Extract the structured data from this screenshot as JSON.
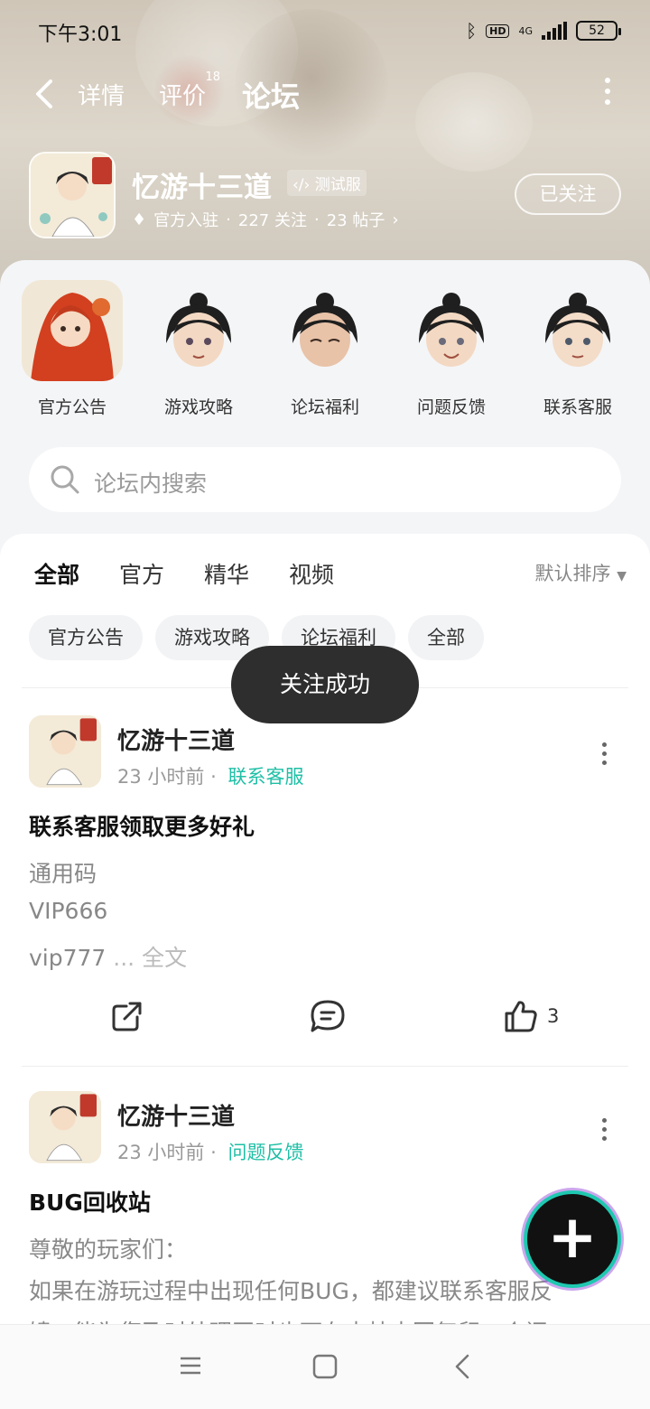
{
  "status": {
    "time": "下午3:01",
    "hd": "HD",
    "net": "4G",
    "battery": "52"
  },
  "nav": {
    "tabs": [
      {
        "label": "详情"
      },
      {
        "label": "评价",
        "badge": "18"
      },
      {
        "label": "论坛"
      }
    ]
  },
  "app": {
    "name": "忆游十三道",
    "tag": "测试服",
    "verified": "官方入驻",
    "followers": "227 关注",
    "posts": "23 帖子",
    "follow_label": "已关注"
  },
  "shortcuts": [
    {
      "label": "官方公告"
    },
    {
      "label": "游戏攻略"
    },
    {
      "label": "论坛福利"
    },
    {
      "label": "问题反馈"
    },
    {
      "label": "联系客服"
    }
  ],
  "search": {
    "placeholder": "论坛内搜索"
  },
  "feed": {
    "tabs": [
      {
        "label": "全部"
      },
      {
        "label": "官方"
      },
      {
        "label": "精华"
      },
      {
        "label": "视频"
      }
    ],
    "sort": "默认排序",
    "chips": [
      {
        "label": "官方公告"
      },
      {
        "label": "游戏攻略"
      },
      {
        "label": "论坛福利"
      },
      {
        "label": "全部"
      }
    ]
  },
  "toast": "关注成功",
  "posts": [
    {
      "author": "忆游十三道",
      "time": "23 小时前",
      "category": "联系客服",
      "title": "联系客服领取更多好礼",
      "lines": [
        "通用码",
        "VIP666",
        "vip777"
      ],
      "more": "... 全文",
      "likes": "3"
    },
    {
      "author": "忆游十三道",
      "time": "23 小时前",
      "category": "问题反馈",
      "title": "BUG回收站",
      "lines": [
        "尊敬的玩家们：",
        " 如果在游玩过程中出现任何BUG，都建议联系客服反",
        "馈，能为您及时处理同时也可在本帖中回复留一个问"
      ]
    }
  ],
  "colors": {
    "accent": "#2ed3b7",
    "category": "#1fbfa6"
  }
}
